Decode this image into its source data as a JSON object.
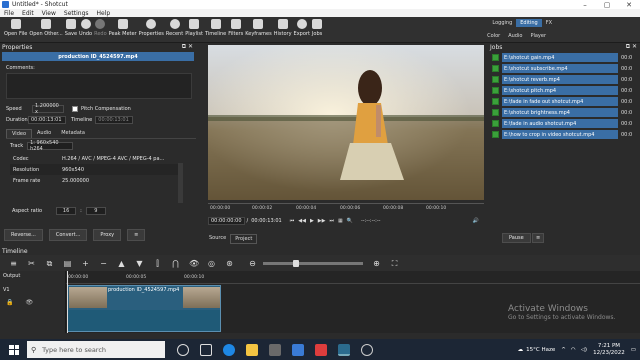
{
  "window": {
    "title": "Untitled* - Shotcut"
  },
  "menu": [
    "File",
    "Edit",
    "View",
    "Settings",
    "Help"
  ],
  "toolbar": [
    {
      "label": "Open File"
    },
    {
      "label": "Open Other..."
    },
    {
      "label": "Save"
    },
    {
      "label": "Undo"
    },
    {
      "label": "Redo"
    },
    {
      "label": "Peak Meter"
    },
    {
      "label": "Properties"
    },
    {
      "label": "Recent"
    },
    {
      "label": "Playlist"
    },
    {
      "label": "Timeline"
    },
    {
      "label": "Filters"
    },
    {
      "label": "Keyframes"
    },
    {
      "label": "History"
    },
    {
      "label": "Export"
    },
    {
      "label": "Jobs"
    }
  ],
  "layouts": {
    "logging": "Logging",
    "editing": "Editing",
    "fx": "FX",
    "color": "Color",
    "audio": "Audio",
    "player": "Player"
  },
  "properties": {
    "panel_title": "Properties",
    "clip_name": "production ID_4524597.mp4",
    "comments_label": "Comments:",
    "speed_label": "Speed",
    "speed_value": "1.200000 x",
    "pitch_label": "Pitch Compensation",
    "duration_label": "Duration",
    "duration_value": "00:00:13:01",
    "timeline_label": "Timeline",
    "timeline_value": "00:00:13:01",
    "tabs": [
      "Video",
      "Audio",
      "Metadata"
    ],
    "track_label": "Track",
    "track_value": "1: 960x540 h264",
    "info": [
      {
        "k": "Codec",
        "v": "H.264 / AVC / MPEG-4 AVC / MPEG-4 pa..."
      },
      {
        "k": "Resolution",
        "v": "960x540"
      },
      {
        "k": "Frame rate",
        "v": "25.000000"
      }
    ],
    "aspect_label": "Aspect ratio",
    "aspect_w": "16",
    "aspect_h": "9",
    "buttons": [
      "Reverse...",
      "Convert...",
      "Proxy",
      "≡"
    ]
  },
  "viewer": {
    "ruler": [
      "00:00:00",
      "00:00:02",
      "00:00:04",
      "00:00:06",
      "00:00:08",
      "00:00:10"
    ],
    "timecode_pos": "00:00:00:00",
    "timecode_dur": "00:00:13:01",
    "in_out": "--:--:--:--",
    "tabs": [
      "Source",
      "Project"
    ]
  },
  "jobs": {
    "title": "Jobs",
    "items": [
      {
        "name": "E:\\shotcut gain.mp4",
        "dur": "00:0"
      },
      {
        "name": "E:\\shotcut subscribe.mp4",
        "dur": "00:0"
      },
      {
        "name": "E:\\shotcut reverb.mp4",
        "dur": "00:0"
      },
      {
        "name": "E:\\shotcut pitch.mp4",
        "dur": "00:0"
      },
      {
        "name": "E:\\fade in fade out shotcut.mp4",
        "dur": "00:0"
      },
      {
        "name": "E:\\shotcut brightness.mp4",
        "dur": "00:0"
      },
      {
        "name": "E:\\fade in audio shotcut.mp4",
        "dur": "00:0"
      },
      {
        "name": "E:\\how to crop in video shotcut.mp4",
        "dur": "00:0"
      }
    ],
    "pause": "Pause",
    "menu": "≡"
  },
  "timeline": {
    "title": "Timeline",
    "output": "Output",
    "track": "V1",
    "ruler": [
      "00:00:00",
      "00:00:05",
      "00:00:10"
    ],
    "clip_label": "production ID_4524597.mp4"
  },
  "watermark": {
    "line1": "Activate Windows",
    "line2": "Go to Settings to activate Windows."
  },
  "taskbar": {
    "search": "Type here to search",
    "weather": "15°C Haze",
    "time": "7:21 PM",
    "date": "12/23/2022"
  }
}
